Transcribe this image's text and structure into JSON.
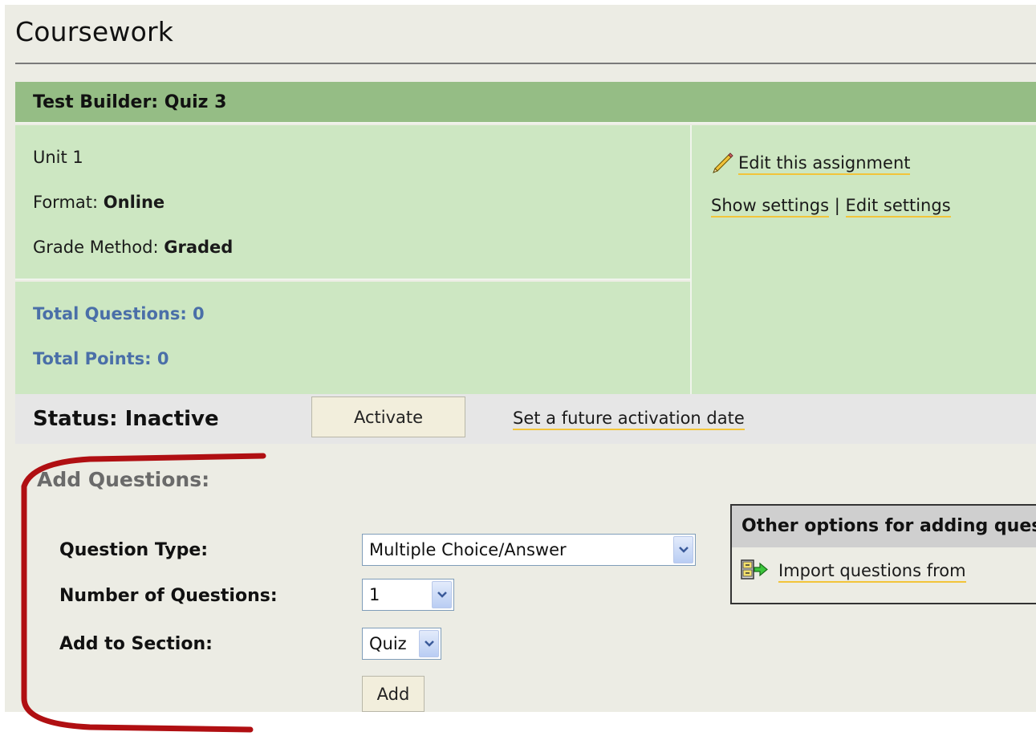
{
  "page": {
    "title": "Coursework"
  },
  "test_builder": {
    "header": "Test Builder: Quiz 3",
    "unit": "Unit 1",
    "format_label": "Format:",
    "format_value": "Online",
    "grade_method_label": "Grade Method:",
    "grade_method_value": "Graded",
    "total_questions": "Total Questions: 0",
    "total_points": "Total Points: 0",
    "edit_assignment_link": "Edit this assignment",
    "show_settings_link": "Show settings",
    "separator": "|",
    "edit_settings_link": "Edit settings"
  },
  "status": {
    "label": "Status: Inactive",
    "activate_button": "Activate",
    "future_link": "Set a future activation date"
  },
  "add_questions": {
    "title": "Add Questions:",
    "question_type_label": "Question Type:",
    "question_type_value": "Multiple Choice/Answer",
    "number_label": "Number of Questions:",
    "number_value": "1",
    "section_label": "Add to Section:",
    "section_value": "Quiz",
    "add_button": "Add"
  },
  "other_options": {
    "header": "Other options for adding questions",
    "import_link": "Import questions from"
  },
  "icons": {
    "pencil": "pencil-icon",
    "import": "import-icon",
    "dropdown": "chevron-down-icon"
  },
  "colors": {
    "header_green": "#95bd85",
    "panel_green": "#cde7c2",
    "link_underline": "#f2c43a",
    "totals_blue": "#4a6fa8",
    "annotation_red": "#b00f12"
  }
}
